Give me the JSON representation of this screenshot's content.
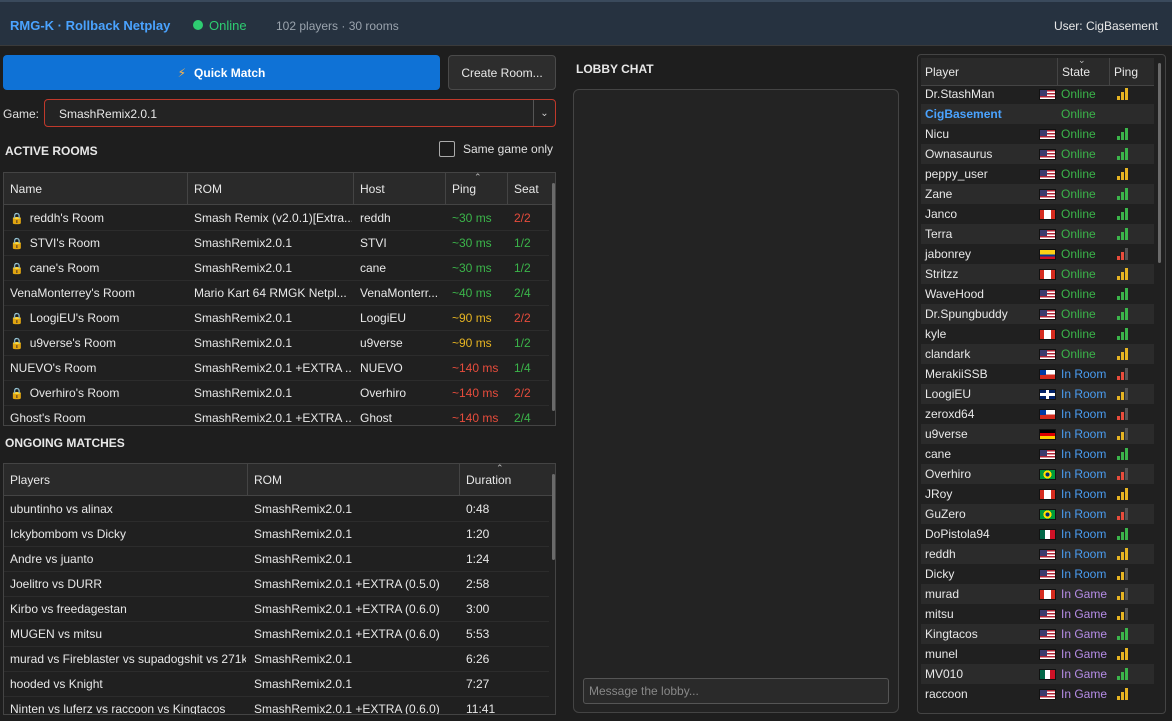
{
  "header": {
    "title": "RMG-K · Rollback Netplay",
    "status": "Online",
    "counts": "102 players · 30 rooms",
    "user": "User: CigBasement"
  },
  "controls": {
    "quick_match": "Quick Match",
    "create_room": "Create Room...",
    "game_label": "Game:",
    "game_value": "SmashRemix2.0.1",
    "same_game_only": "Same game only"
  },
  "active_rooms": {
    "title": "ACTIVE ROOMS",
    "columns": [
      "Name",
      "ROM",
      "Host",
      "Ping",
      "Seat"
    ],
    "rows": [
      {
        "locked": true,
        "name": "reddh's Room",
        "rom": "Smash Remix (v2.0.1)[Extra...",
        "host": "reddh",
        "ping": "~30 ms",
        "ping_color": "#3bb54a",
        "seat": "2/2",
        "seat_color": "#e74c3c"
      },
      {
        "locked": true,
        "name": "STVI's Room",
        "rom": "SmashRemix2.0.1",
        "host": "STVI",
        "ping": "~30 ms",
        "ping_color": "#3bb54a",
        "seat": "1/2",
        "seat_color": "#3bb54a"
      },
      {
        "locked": true,
        "name": "cane's Room",
        "rom": "SmashRemix2.0.1",
        "host": "cane",
        "ping": "~30 ms",
        "ping_color": "#3bb54a",
        "seat": "1/2",
        "seat_color": "#3bb54a"
      },
      {
        "locked": false,
        "name": "VenaMonterrey's Room",
        "rom": "Mario Kart 64 RMGK Netpl...",
        "host": "VenaMonterr...",
        "ping": "~40 ms",
        "ping_color": "#3bb54a",
        "seat": "2/4",
        "seat_color": "#3bb54a"
      },
      {
        "locked": true,
        "name": "LoogiEU's Room",
        "rom": "SmashRemix2.0.1",
        "host": "LoogiEU",
        "ping": "~90 ms",
        "ping_color": "#e6b422",
        "seat": "2/2",
        "seat_color": "#e74c3c"
      },
      {
        "locked": true,
        "name": "u9verse's Room",
        "rom": "SmashRemix2.0.1",
        "host": "u9verse",
        "ping": "~90 ms",
        "ping_color": "#e6b422",
        "seat": "1/2",
        "seat_color": "#3bb54a"
      },
      {
        "locked": false,
        "name": "NUEVO's Room",
        "rom": "SmashRemix2.0.1 +EXTRA ...",
        "host": "NUEVO",
        "ping": "~140 ms",
        "ping_color": "#e74c3c",
        "seat": "1/4",
        "seat_color": "#3bb54a"
      },
      {
        "locked": true,
        "name": "Overhiro's Room",
        "rom": "SmashRemix2.0.1",
        "host": "Overhiro",
        "ping": "~140 ms",
        "ping_color": "#e74c3c",
        "seat": "2/2",
        "seat_color": "#e74c3c"
      },
      {
        "locked": false,
        "name": "Ghost's Room",
        "rom": "SmashRemix2.0.1 +EXTRA ...",
        "host": "Ghost",
        "ping": "~140 ms",
        "ping_color": "#e74c3c",
        "seat": "2/4",
        "seat_color": "#3bb54a"
      }
    ]
  },
  "ongoing_matches": {
    "title": "ONGOING MATCHES",
    "columns": [
      "Players",
      "ROM",
      "Duration"
    ],
    "rows": [
      {
        "players": "ubuntinho vs alinax",
        "rom": "SmashRemix2.0.1",
        "duration": "0:48"
      },
      {
        "players": "Ickybombom vs Dicky",
        "rom": "SmashRemix2.0.1",
        "duration": "1:20"
      },
      {
        "players": "Andre vs juanto",
        "rom": "SmashRemix2.0.1",
        "duration": "1:24"
      },
      {
        "players": "Joelitro vs DURR",
        "rom": "SmashRemix2.0.1 +EXTRA (0.5.0)",
        "duration": "2:58"
      },
      {
        "players": "Kirbo vs freedagestan",
        "rom": "SmashRemix2.0.1 +EXTRA (0.6.0)",
        "duration": "3:00"
      },
      {
        "players": "MUGEN vs mitsu",
        "rom": "SmashRemix2.0.1 +EXTRA (0.6.0)",
        "duration": "5:53"
      },
      {
        "players": "murad vs Fireblaster vs supadogshit vs 271k",
        "rom": "SmashRemix2.0.1",
        "duration": "6:26"
      },
      {
        "players": "hooded vs Knight",
        "rom": "SmashRemix2.0.1",
        "duration": "7:27"
      },
      {
        "players": "Ninten vs luferz vs raccoon vs Kingtacos",
        "rom": "SmashRemix2.0.1 +EXTRA (0.6.0)",
        "duration": "11:41"
      }
    ]
  },
  "chat": {
    "title": "LOBBY CHAT",
    "placeholder": "Message the lobby..."
  },
  "players": {
    "columns": [
      "Player",
      "State",
      "Ping"
    ],
    "rows": [
      {
        "name": "Dr.StashMan",
        "flag": "us",
        "state": "Online",
        "bars": 3,
        "bar_color": "#e6b422"
      },
      {
        "name": "CigBasement",
        "flag": "none",
        "state": "Online",
        "bars": 0,
        "bar_color": "#3bb54a",
        "me": true
      },
      {
        "name": "Nicu",
        "flag": "us",
        "state": "Online",
        "bars": 3,
        "bar_color": "#3bb54a"
      },
      {
        "name": "Ownasaurus",
        "flag": "us",
        "state": "Online",
        "bars": 3,
        "bar_color": "#3bb54a"
      },
      {
        "name": "peppy_user",
        "flag": "us",
        "state": "Online",
        "bars": 3,
        "bar_color": "#e6b422"
      },
      {
        "name": "Zane",
        "flag": "us",
        "state": "Online",
        "bars": 3,
        "bar_color": "#3bb54a"
      },
      {
        "name": "Janco",
        "flag": "ca",
        "state": "Online",
        "bars": 3,
        "bar_color": "#3bb54a"
      },
      {
        "name": "Terra",
        "flag": "us",
        "state": "Online",
        "bars": 3,
        "bar_color": "#3bb54a"
      },
      {
        "name": "jabonrey",
        "flag": "co",
        "state": "Online",
        "bars": 2,
        "bar_color": "#e74c3c"
      },
      {
        "name": "Stritzz",
        "flag": "ca",
        "state": "Online",
        "bars": 3,
        "bar_color": "#e6b422"
      },
      {
        "name": "WaveHood",
        "flag": "us",
        "state": "Online",
        "bars": 3,
        "bar_color": "#3bb54a"
      },
      {
        "name": "Dr.Spungbuddy",
        "flag": "us",
        "state": "Online",
        "bars": 3,
        "bar_color": "#3bb54a"
      },
      {
        "name": "kyle",
        "flag": "ca",
        "state": "Online",
        "bars": 3,
        "bar_color": "#3bb54a"
      },
      {
        "name": "clandark",
        "flag": "us",
        "state": "Online",
        "bars": 3,
        "bar_color": "#e6b422"
      },
      {
        "name": "MerakiiSSB",
        "flag": "cl",
        "state": "In Room",
        "bars": 2,
        "bar_color": "#e74c3c"
      },
      {
        "name": "LoogiEU",
        "flag": "gb",
        "state": "In Room",
        "bars": 2,
        "bar_color": "#e6b422"
      },
      {
        "name": "zeroxd64",
        "flag": "cl",
        "state": "In Room",
        "bars": 2,
        "bar_color": "#e74c3c"
      },
      {
        "name": "u9verse",
        "flag": "de",
        "state": "In Room",
        "bars": 2,
        "bar_color": "#e6b422"
      },
      {
        "name": "cane",
        "flag": "us",
        "state": "In Room",
        "bars": 3,
        "bar_color": "#3bb54a"
      },
      {
        "name": "Overhiro",
        "flag": "br",
        "state": "In Room",
        "bars": 2,
        "bar_color": "#e74c3c"
      },
      {
        "name": "JRoy",
        "flag": "ca",
        "state": "In Room",
        "bars": 3,
        "bar_color": "#e6b422"
      },
      {
        "name": "GuZero",
        "flag": "br",
        "state": "In Room",
        "bars": 2,
        "bar_color": "#e74c3c"
      },
      {
        "name": "DoPistola94",
        "flag": "mx",
        "state": "In Room",
        "bars": 3,
        "bar_color": "#3bb54a"
      },
      {
        "name": "reddh",
        "flag": "us",
        "state": "In Room",
        "bars": 3,
        "bar_color": "#e6b422"
      },
      {
        "name": "Dicky",
        "flag": "us",
        "state": "In Room",
        "bars": 2,
        "bar_color": "#e6b422"
      },
      {
        "name": "murad",
        "flag": "ca",
        "state": "In Game",
        "bars": 2,
        "bar_color": "#e6b422"
      },
      {
        "name": "mitsu",
        "flag": "us",
        "state": "In Game",
        "bars": 2,
        "bar_color": "#e6b422"
      },
      {
        "name": "Kingtacos",
        "flag": "us",
        "state": "In Game",
        "bars": 3,
        "bar_color": "#3bb54a"
      },
      {
        "name": "munel",
        "flag": "us",
        "state": "In Game",
        "bars": 3,
        "bar_color": "#e6b422"
      },
      {
        "name": "MV010",
        "flag": "mx",
        "state": "In Game",
        "bars": 3,
        "bar_color": "#3bb54a"
      },
      {
        "name": "raccoon",
        "flag": "us",
        "state": "In Game",
        "bars": 3,
        "bar_color": "#e6b422"
      }
    ]
  }
}
